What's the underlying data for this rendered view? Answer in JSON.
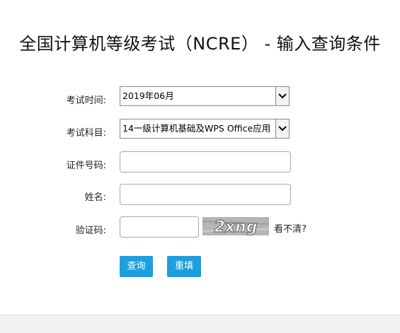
{
  "page": {
    "title": "全国计算机等级考试（NCRE） - 输入查询条件"
  },
  "form": {
    "exam_time": {
      "label": "考试时间:",
      "selected": "2019年06月"
    },
    "exam_subject": {
      "label": "考试科目:",
      "selected": "14一级计算机基础及WPS Office应用"
    },
    "id_number": {
      "label": "证件号码:",
      "value": ""
    },
    "name": {
      "label": "姓名:",
      "value": ""
    },
    "captcha": {
      "label": "验证码:",
      "value": "",
      "image_text": "2xng",
      "refresh_link": "看不清?"
    },
    "buttons": {
      "query_label": "查询",
      "reset_label": "重填"
    }
  },
  "colors": {
    "button_bg": "#1c9fdf",
    "button_text": "#ffffff",
    "footer_bg": "#f2f2f2"
  },
  "icons": {
    "select_arrow": "chevron-down-icon"
  }
}
